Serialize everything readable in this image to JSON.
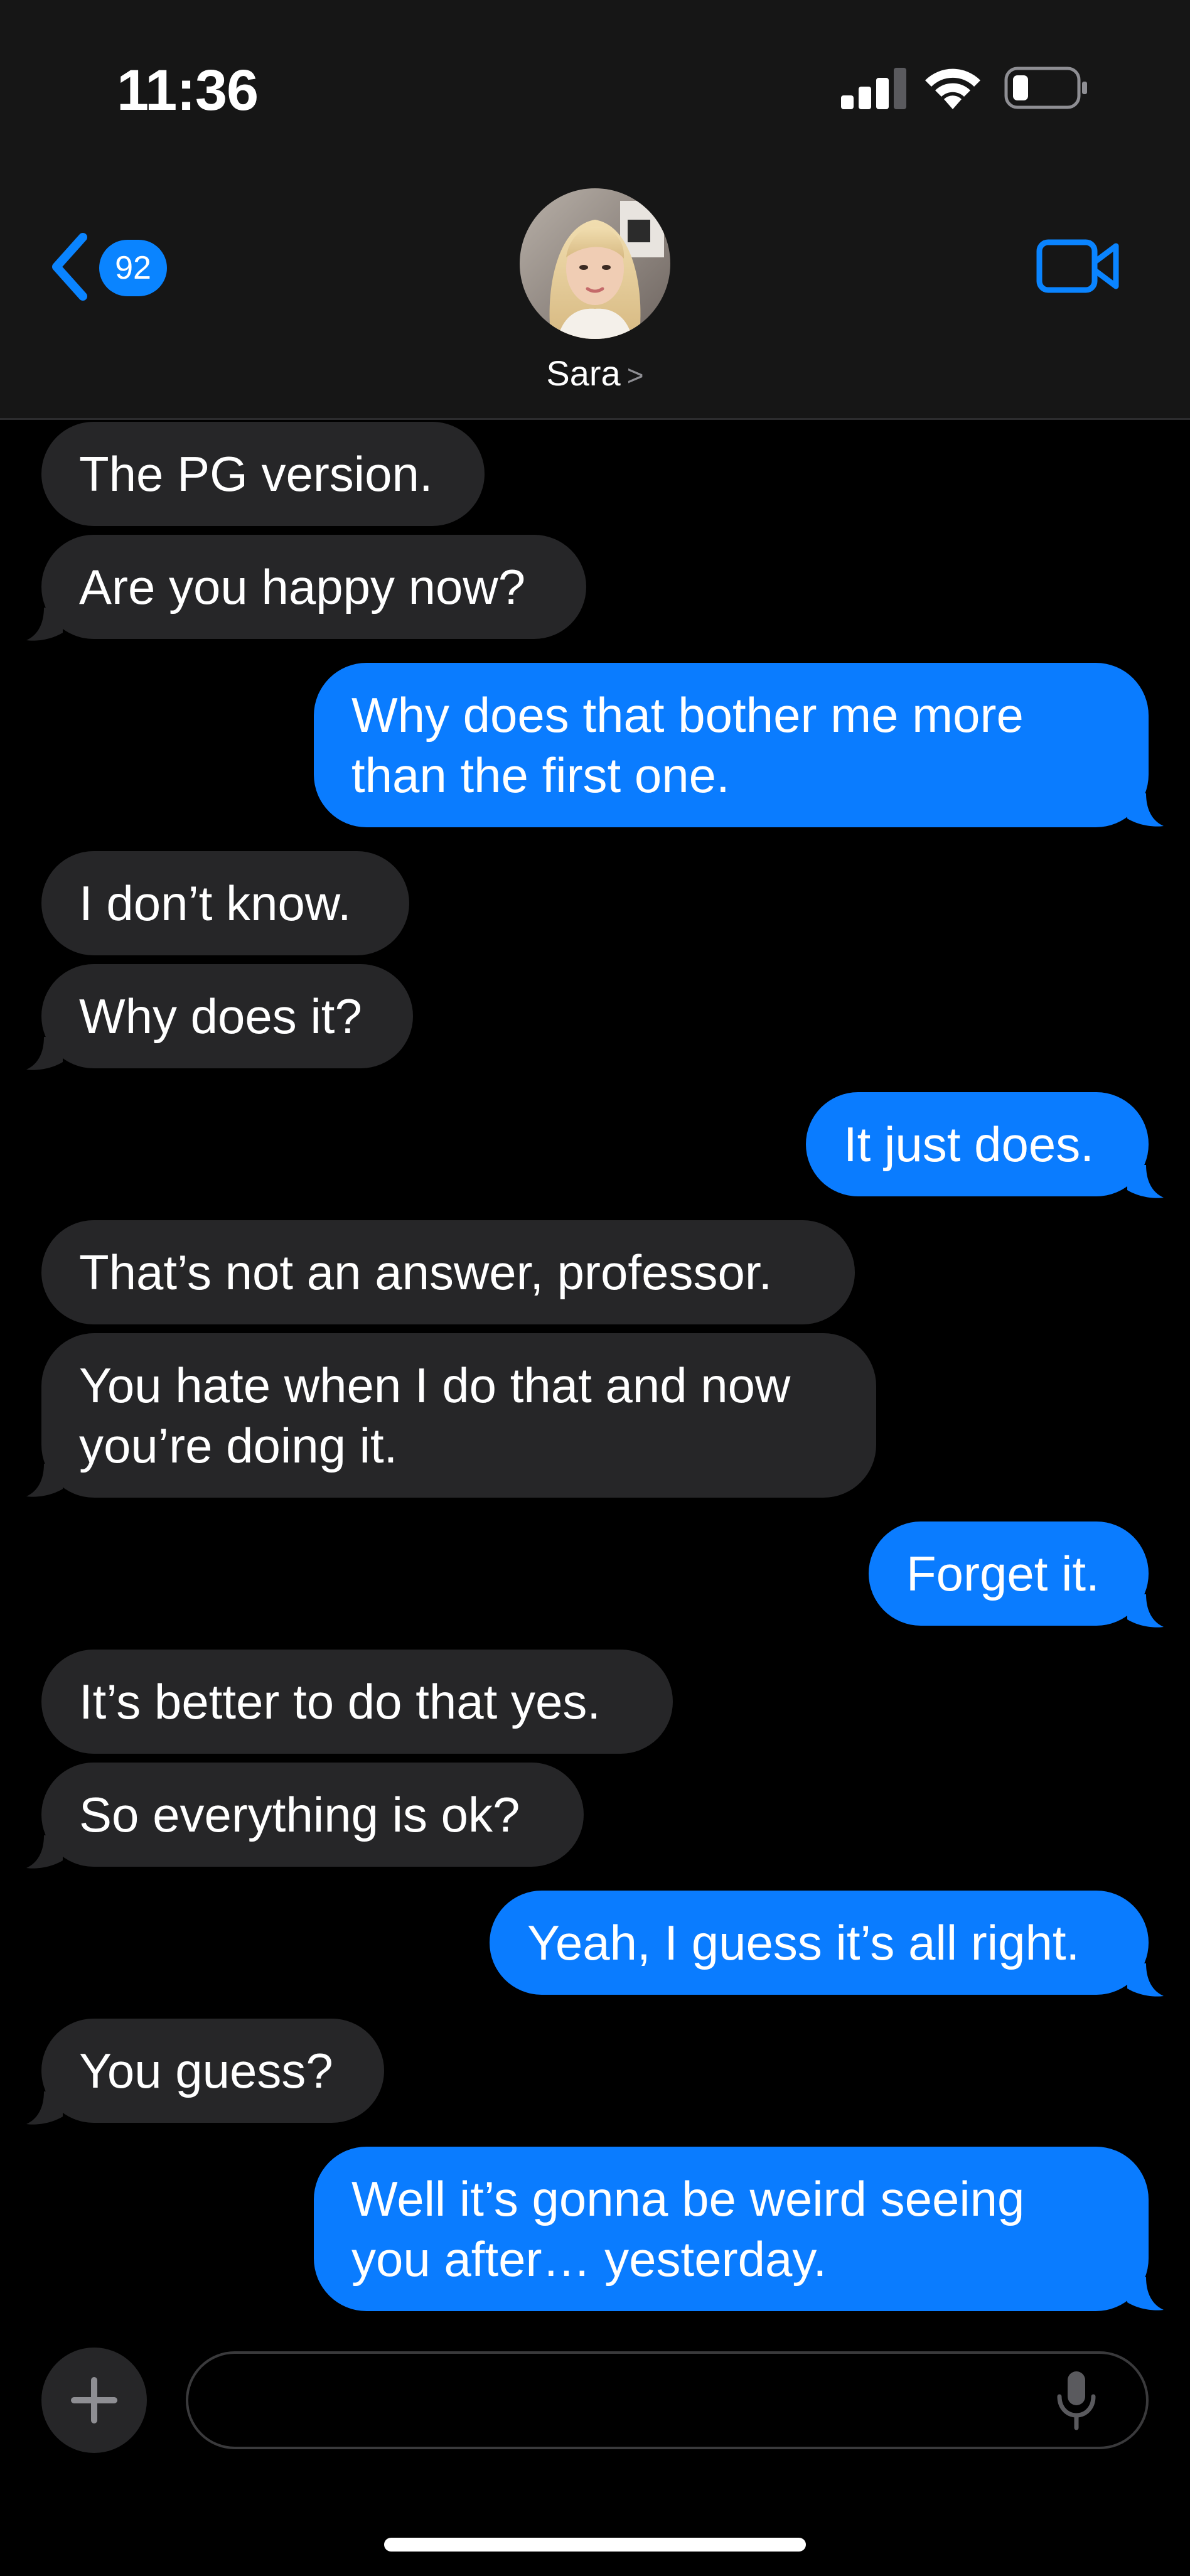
{
  "status_bar": {
    "time": "11:36"
  },
  "header": {
    "back_count": "92",
    "contact_name": "Sara",
    "chevron": ">"
  },
  "messages": [
    {
      "from": "them",
      "text": "The PG version."
    },
    {
      "from": "them",
      "text": "Are you happy now?"
    },
    {
      "from": "me",
      "lines": [
        "Why does that bother me more",
        "than the first one."
      ]
    },
    {
      "from": "them",
      "text": "I don’t know."
    },
    {
      "from": "them",
      "text": "Why does it?"
    },
    {
      "from": "me",
      "text": "It just does."
    },
    {
      "from": "them",
      "text": "That’s not an answer, professor."
    },
    {
      "from": "them",
      "lines": [
        "You hate when I do that and now",
        "you’re doing it."
      ]
    },
    {
      "from": "me",
      "text": "Forget it."
    },
    {
      "from": "them",
      "text": "It’s better to do that yes."
    },
    {
      "from": "them",
      "text": "So everything is ok?"
    },
    {
      "from": "me",
      "text": "Yeah, I guess it’s all right."
    },
    {
      "from": "them",
      "text": "You guess?"
    },
    {
      "from": "me",
      "lines": [
        "Well it’s gonna be weird seeing",
        "you after… yesterday."
      ]
    }
  ],
  "composer": {
    "placeholder": ""
  },
  "colors": {
    "sent_bubble": "#0a7cff",
    "received_bubble": "#262628",
    "accent": "#0a84ff",
    "header_bg": "#161616"
  },
  "icons": [
    "signal-icon",
    "wifi-icon",
    "battery-icon",
    "back-chevron-icon",
    "video-camera-icon",
    "plus-icon",
    "microphone-icon"
  ]
}
